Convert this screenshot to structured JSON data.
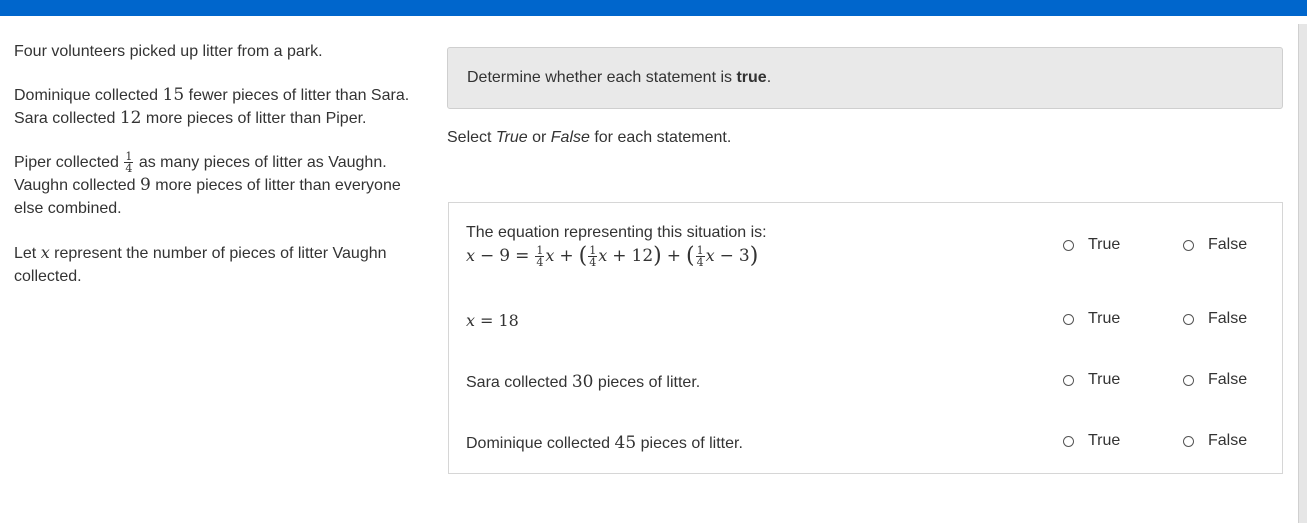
{
  "passage": {
    "p1": "Four volunteers picked up litter from a park.",
    "p2": {
      "a": "Dominique collected ",
      "n1": "15",
      "b": " fewer pieces of litter than Sara. Sara collected ",
      "n2": "12",
      "c": " more pieces of litter than Piper."
    },
    "p3": {
      "a": "Piper collected ",
      "frac_num": "1",
      "frac_den": "4",
      "b": " as many pieces of litter as Vaughn. Vaughn collected ",
      "n": "9",
      "c": " more pieces of litter than everyone else combined."
    },
    "p4": {
      "a": "Let ",
      "var": "x",
      "b": " represent the number of pieces of litter Vaughn collected."
    }
  },
  "prompt": {
    "text": "Determine whether each statement is ",
    "bold": "true",
    "end": "."
  },
  "instruction": {
    "a": "Select ",
    "true_word": "True",
    "mid": " or ",
    "false_word": "False",
    "b": " for each statement."
  },
  "options": {
    "true_label": "True",
    "false_label": "False"
  },
  "statements": {
    "s1": {
      "text": "The equation representing this situation is:",
      "eq": {
        "x": "x",
        "minus": "−",
        "nine": "9",
        "eq": "=",
        "f_num": "1",
        "f_den": "4",
        "plus": "+",
        "twelve": "12",
        "three": "3",
        "lparen": "(",
        "rparen": ")"
      }
    },
    "s2": {
      "x": "x",
      "eq": "=",
      "val": "18"
    },
    "s3": {
      "a": "Sara collected ",
      "n": "30",
      "b": " pieces of litter."
    },
    "s4": {
      "a": "Dominique collected ",
      "n": "45",
      "b": " pieces of litter."
    }
  }
}
